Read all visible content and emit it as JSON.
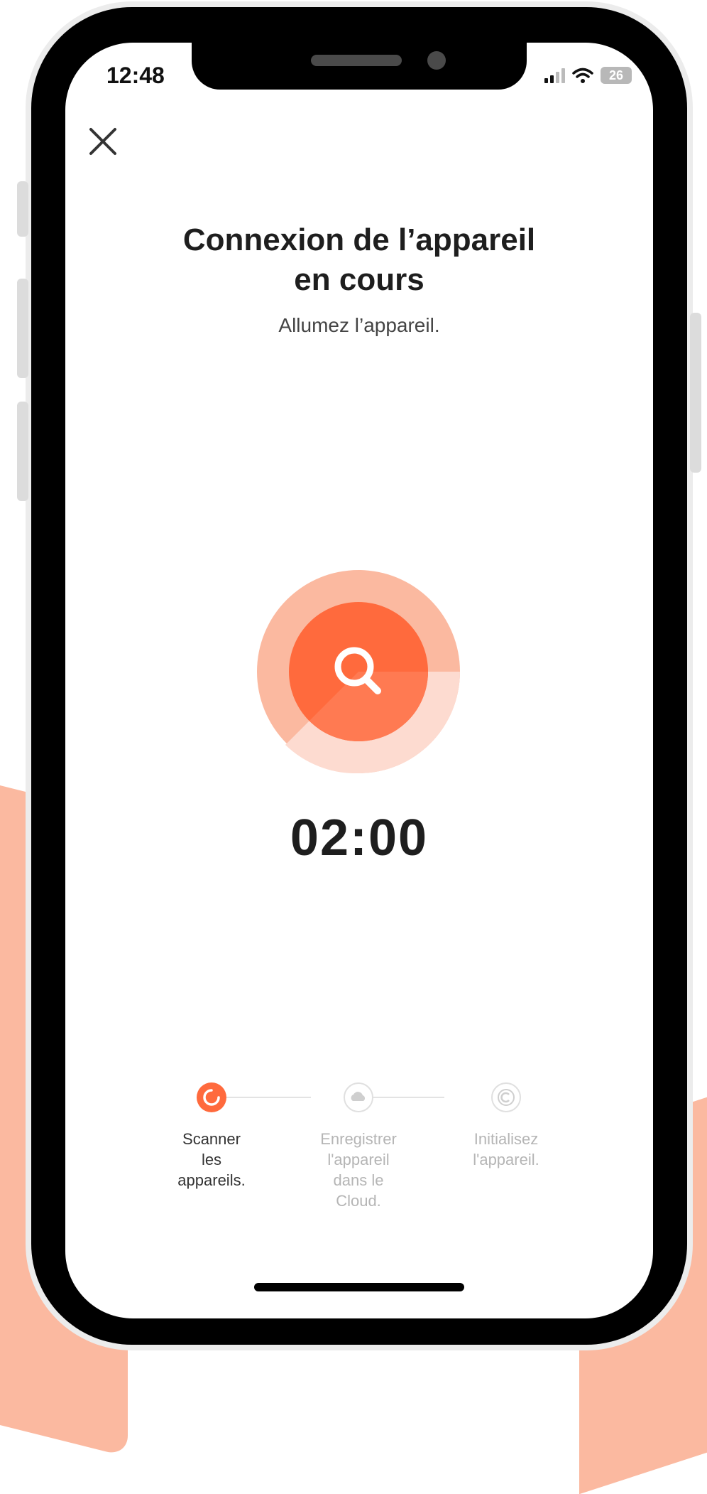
{
  "status_bar": {
    "time": "12:48",
    "battery": "26"
  },
  "header": {
    "close_icon": "close-icon",
    "title_line1": "Connexion de l’appareil",
    "title_line2": "en cours",
    "subtitle": "Allumez l’appareil."
  },
  "scan": {
    "icon": "search-icon",
    "timer": "02:00"
  },
  "steps": [
    {
      "label_lines": [
        "Scanner",
        "les",
        "appareils."
      ],
      "state": "active",
      "icon": "spinner-icon"
    },
    {
      "label_lines": [
        "Enregistrer",
        "l'appareil",
        "dans le",
        "Cloud."
      ],
      "state": "pending",
      "icon": "cloud-icon"
    },
    {
      "label_lines": [
        "Initialisez",
        "l'appareil."
      ],
      "state": "pending",
      "icon": "copyright-icon"
    }
  ],
  "colors": {
    "accent": "#ff6a3d",
    "accent_light": "#fbb9a0"
  }
}
